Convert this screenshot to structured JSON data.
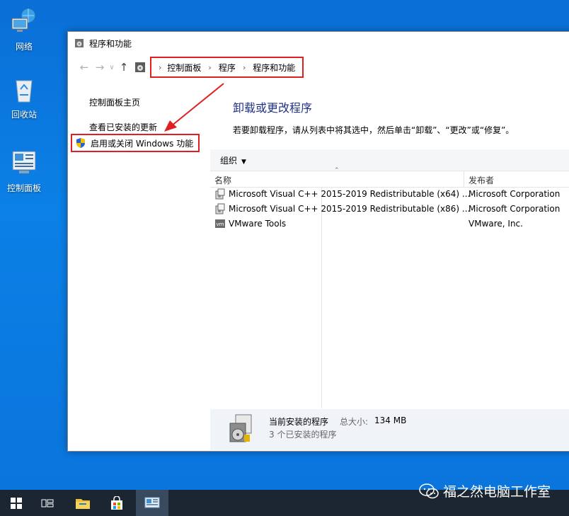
{
  "desktop": {
    "icons": [
      {
        "label": "网络",
        "icon": "network-icon"
      },
      {
        "label": "回收站",
        "icon": "recycle-bin-icon"
      },
      {
        "label": "控制面板",
        "icon": "control-panel-icon"
      }
    ]
  },
  "window": {
    "title": "程序和功能",
    "breadcrumb": [
      "控制面板",
      "程序",
      "程序和功能"
    ],
    "left_pane": {
      "home": "控制面板主页",
      "updates": "查看已安装的更新",
      "features": "启用或关闭 Windows 功能"
    },
    "heading": "卸载或更改程序",
    "instruction": "若要卸载程序，请从列表中将其选中，然后单击“卸载”、“更改”或“修复”。",
    "toolbar": {
      "organize": "组织"
    },
    "columns": {
      "name": "名称",
      "publisher": "发布者"
    },
    "programs": [
      {
        "name": "Microsoft Visual C++ 2015-2019 Redistributable (x64) ...",
        "publisher": "Microsoft Corporation",
        "icon": "installer-icon"
      },
      {
        "name": "Microsoft Visual C++ 2015-2019 Redistributable (x86) ...",
        "publisher": "Microsoft Corporation",
        "icon": "installer-icon"
      },
      {
        "name": "VMware Tools",
        "publisher": "VMware, Inc.",
        "icon": "vmware-icon"
      }
    ],
    "status": {
      "current": "当前安装的程序",
      "size_label": "总大小:",
      "size": "134 MB",
      "count": "3 个已安装的程序"
    }
  },
  "watermark": "福之然电脑工作室",
  "colors": {
    "highlight_box": "#e02020",
    "heading": "#1e3287",
    "desktop": "#0b7be2",
    "taskbar": "#1c2633"
  }
}
